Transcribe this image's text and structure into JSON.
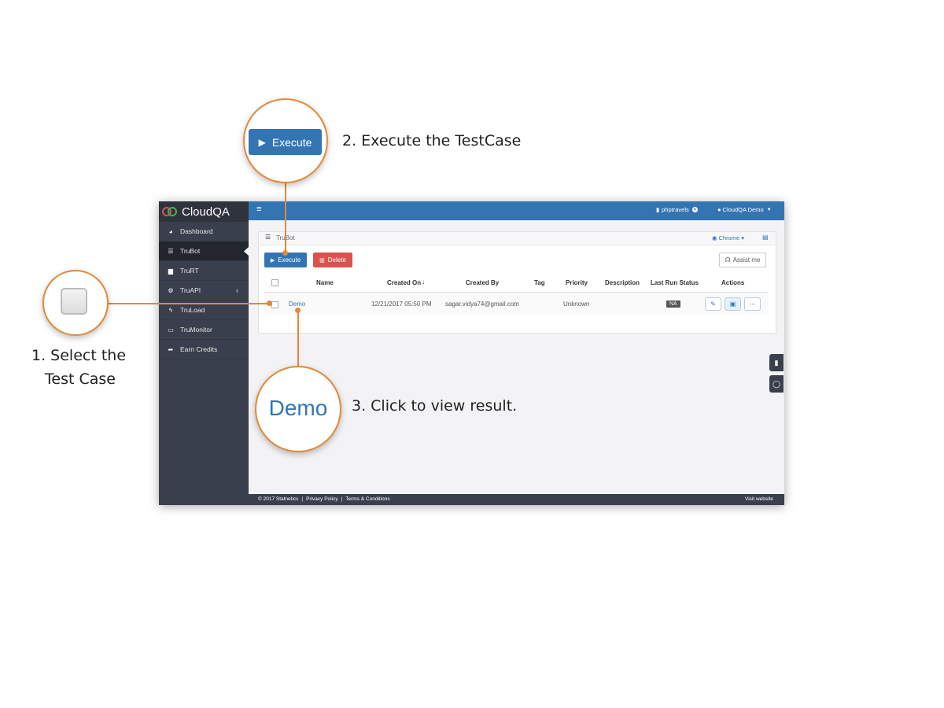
{
  "app": {
    "logo": "CloudQA",
    "topbar": {
      "project": "phptravels",
      "user": "CloudQA Demo"
    },
    "sidebar": {
      "items": [
        {
          "label": "Dashboard",
          "icon": "dashboard-icon"
        },
        {
          "label": "TruBot",
          "icon": "list-icon"
        },
        {
          "label": "TruRT",
          "icon": "briefcase-icon"
        },
        {
          "label": "TruAPI",
          "icon": "gears-icon"
        },
        {
          "label": "TruLoad",
          "icon": "bolt-icon"
        },
        {
          "label": "TruMonitor",
          "icon": "monitor-icon"
        },
        {
          "label": "Earn Credits",
          "icon": "share-icon"
        }
      ]
    },
    "panel": {
      "title": "TruBot",
      "browser": "Chrome",
      "execute_label": "Execute",
      "delete_label": "Delete",
      "assist_label": "Assist me"
    },
    "table": {
      "headers": {
        "name": "Name",
        "created_on": "Created On",
        "created_by": "Created By",
        "tag": "Tag",
        "priority": "Priority",
        "description": "Description",
        "last_run_status": "Last Run Status",
        "actions": "Actions"
      },
      "rows": [
        {
          "name": "Demo",
          "created_on": "12/21/2017 05:50 PM",
          "created_by": "sagar.vidya74@gmail.com",
          "tag": "",
          "priority": "Unknown",
          "description": "",
          "last_run_status": "NA"
        }
      ]
    },
    "footer": {
      "copyright": "© 2017 Statnetics",
      "privacy": "Privacy Policy",
      "terms": "Terms & Conditions",
      "visit": "Visit website"
    }
  },
  "callouts": {
    "step1": {
      "line1": "1. Select the",
      "line2": "Test Case"
    },
    "step2": {
      "button_label": "Execute",
      "text": "2. Execute the TestCase"
    },
    "step3": {
      "demo_label": "Demo",
      "text": "3. Click to view result."
    }
  },
  "colors": {
    "accent": "#3375b3",
    "callout": "#e2893a",
    "delete": "#d9534f",
    "sidebar": "#3a3f4d"
  }
}
